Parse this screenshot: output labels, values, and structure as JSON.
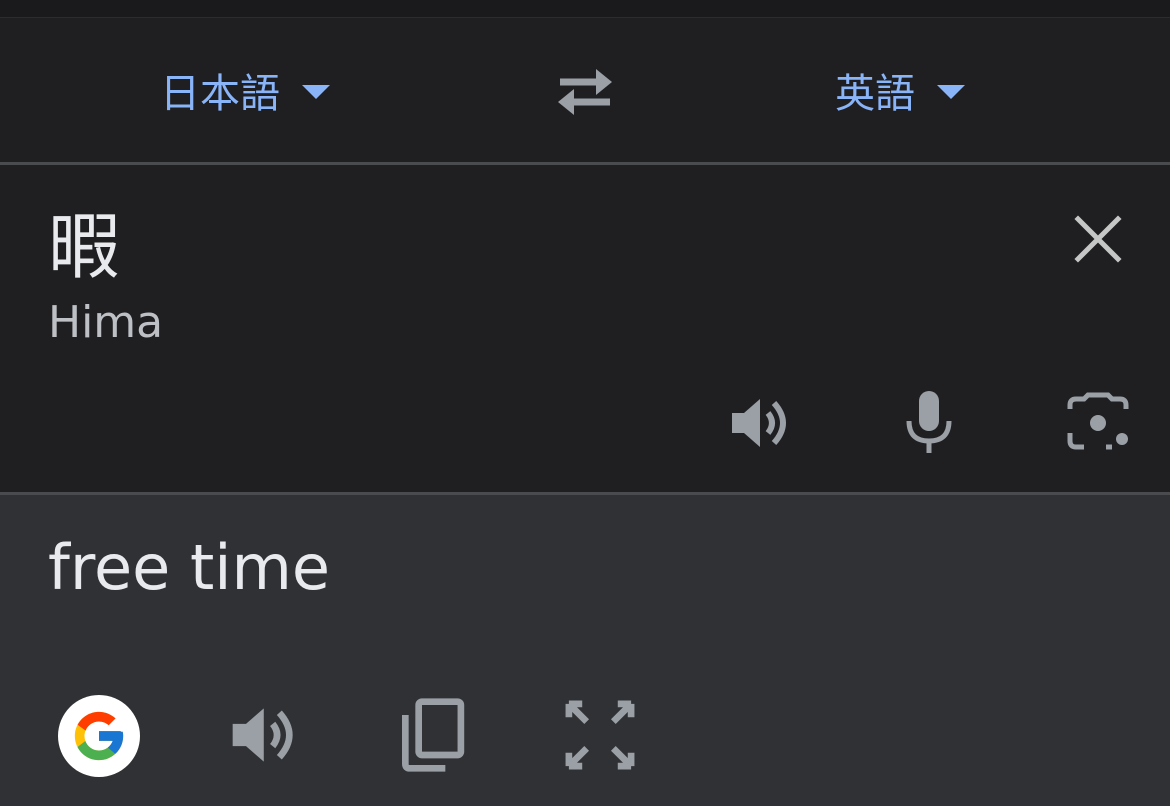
{
  "languages": {
    "source": "日本語",
    "target": "英語"
  },
  "source": {
    "text": "暇",
    "transliteration": "Hima"
  },
  "result": {
    "text": "free time"
  },
  "icons": {
    "caret": "caret-down-icon",
    "swap": "swap-arrows-icon",
    "clear": "close-icon",
    "speak": "speaker-icon",
    "mic": "microphone-icon",
    "camera": "camera-lens-icon",
    "google": "google-logo-icon",
    "copy": "copy-icon",
    "expand": "fullscreen-icon"
  },
  "colors": {
    "accent": "#8ab4f8",
    "background": "#1f1f21",
    "result_background": "#303134",
    "icon": "#9aa0a6",
    "text": "#e8eaed"
  }
}
